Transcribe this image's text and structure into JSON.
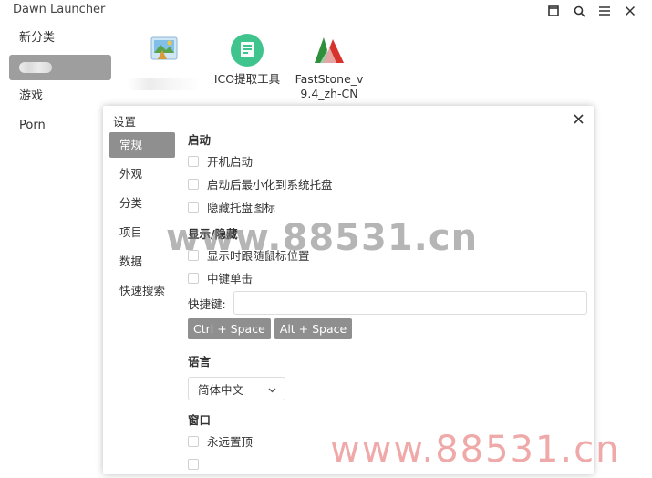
{
  "app": {
    "title": "Dawn Launcher",
    "icons": [
      "maximize-icon",
      "search-icon",
      "menu-icon",
      "close-icon"
    ]
  },
  "sidebar": {
    "items": [
      {
        "label": "新分类",
        "active": false
      },
      {
        "label": "",
        "active": true
      },
      {
        "label": "游戏",
        "active": false
      },
      {
        "label": "Porn",
        "active": false
      }
    ]
  },
  "grid": {
    "items": [
      {
        "label": "",
        "icon": "picture-app-icon"
      },
      {
        "label": "ICO提取工具",
        "icon": "ico-extractor-icon"
      },
      {
        "label": "FastStone_v9.4_zh-CN",
        "icon": "faststone-icon"
      }
    ]
  },
  "settings": {
    "title": "设置",
    "nav": [
      {
        "label": "常规",
        "active": true
      },
      {
        "label": "外观",
        "active": false
      },
      {
        "label": "分类",
        "active": false
      },
      {
        "label": "项目",
        "active": false
      },
      {
        "label": "数据",
        "active": false
      },
      {
        "label": "快速搜索",
        "active": false
      }
    ],
    "startup": {
      "title": "启动",
      "options": [
        "开机启动",
        "启动后最小化到系统托盘",
        "隐藏托盘图标"
      ]
    },
    "show_hide": {
      "title": "显示/隐藏",
      "options": [
        "显示时跟随鼠标位置",
        "中键单击"
      ],
      "hotkey_label": "快捷键:",
      "hotkey_value": "",
      "presets": [
        "Ctrl + Space",
        "Alt + Space"
      ]
    },
    "language": {
      "title": "语言",
      "selected": "简体中文"
    },
    "window": {
      "title": "窗口",
      "options": [
        "永远置顶"
      ]
    }
  },
  "watermarks": {
    "center": "www.88531.cn",
    "corner": "www.88531.cn"
  },
  "colors": {
    "active_nav": "#8f8f8f",
    "chip": "#8f8f8f",
    "watermark_corner": "#eb8c8c"
  }
}
